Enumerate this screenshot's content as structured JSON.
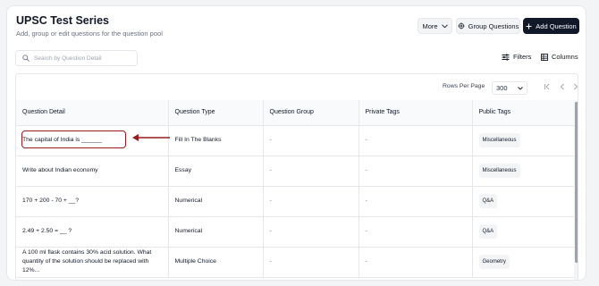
{
  "header": {
    "title": "UPSC Test Series",
    "subtitle": "Add, group or edit questions for the question pool",
    "more_label": "More",
    "group_label": "Group Questions",
    "add_label": "Add Question"
  },
  "search": {
    "placeholder": "Search by Question Detail"
  },
  "toolbar": {
    "filters_label": "Filters",
    "columns_label": "Columns"
  },
  "pagination": {
    "rows_per_page_label": "Rows Per Page",
    "rows_per_page_value": "300"
  },
  "table": {
    "columns": [
      "Question Detail",
      "Question Type",
      "Question Group",
      "Private Tags",
      "Public Tags"
    ],
    "rows": [
      {
        "detail": "The capital of India is ______",
        "type": "Fill In The Blanks",
        "group": "-",
        "private": "-",
        "public": "Miscellaneous"
      },
      {
        "detail": "Write about Indian economy",
        "type": "Essay",
        "group": "-",
        "private": "-",
        "public": "Miscellaneous"
      },
      {
        "detail": "170 + 200 - 70 + __?",
        "type": "Numerical",
        "group": "-",
        "private": "-",
        "public": "Q&A"
      },
      {
        "detail": "2.49 + 2.50 = __ ?",
        "type": "Numerical",
        "group": "-",
        "private": "-",
        "public": "Q&A"
      },
      {
        "detail": "A 100 ml flask contains 30% acid solution. What quantity of the solution should be replaced with 12%...",
        "type": "Multiple Choice",
        "group": "-",
        "private": "-",
        "public": "Geometry"
      }
    ]
  },
  "colors": {
    "accent": "#111827",
    "annotation": "#991b1b"
  }
}
